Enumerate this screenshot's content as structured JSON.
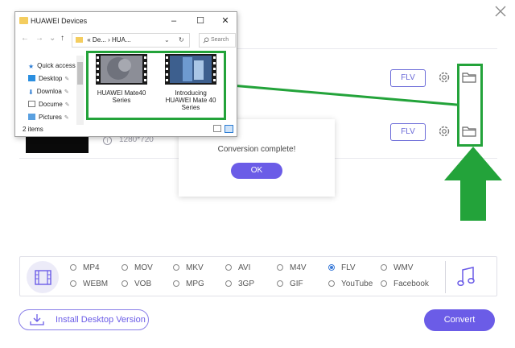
{
  "close_icon": "close-icon",
  "rows": [
    {
      "format_label": "FLV"
    },
    {
      "format_label": "FLV",
      "resolution": "1280*720"
    }
  ],
  "dialog": {
    "message": "Conversion complete!",
    "ok_label": "OK"
  },
  "explorer": {
    "title": "HUAWEI Devices",
    "address": [
      "«",
      "De...",
      "›",
      "HUA..."
    ],
    "search_placeholder": "Search",
    "nav_items": [
      "Quick access",
      "Desktop",
      "Downloa",
      "Docume",
      "Pictures"
    ],
    "files": [
      {
        "name": "HUAWEI Mate40 Series"
      },
      {
        "name": "Introducing HUAWEI Mate 40 Series"
      }
    ],
    "status": "2 items"
  },
  "formats": {
    "row1": [
      "MP4",
      "MOV",
      "MKV",
      "AVI",
      "M4V",
      "FLV",
      "WMV"
    ],
    "row2": [
      "WEBM",
      "VOB",
      "MPG",
      "3GP",
      "GIF",
      "YouTube",
      "Facebook"
    ],
    "selected": "FLV"
  },
  "footer": {
    "install_label": "Install Desktop Version",
    "convert_label": "Convert"
  },
  "colors": {
    "accent": "#6b5ce7",
    "annotation_green": "#23a33a"
  }
}
